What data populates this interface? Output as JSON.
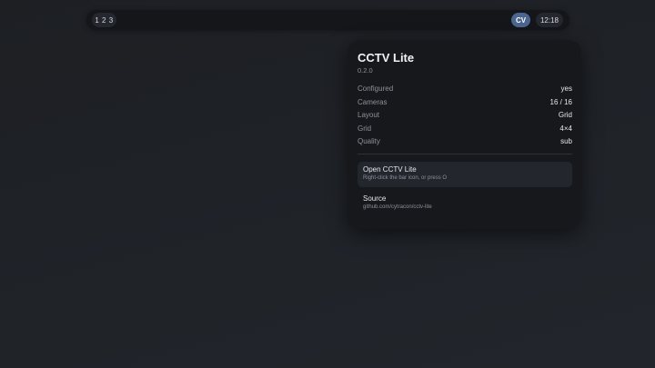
{
  "bar": {
    "workspaces": "1 2 3",
    "app_badge": "CV",
    "clock": "12:18"
  },
  "panel": {
    "title": "CCTV Lite",
    "version": "0.2.0",
    "rows": [
      {
        "key": "Configured",
        "value": "yes"
      },
      {
        "key": "Cameras",
        "value": "16 / 16"
      },
      {
        "key": "Layout",
        "value": "Grid"
      },
      {
        "key": "Grid",
        "value": "4×4"
      },
      {
        "key": "Quality",
        "value": "sub"
      }
    ],
    "actions": [
      {
        "label": "Open CCTV Lite",
        "sub": "Right-click the bar icon, or press O"
      },
      {
        "label": "Source",
        "sub": "github.com/cytracon/cctv-lite"
      }
    ]
  },
  "colors": {
    "accent": "#4a6690",
    "panel_bg": "#16181c",
    "desktop_bg": "#1f2227"
  }
}
